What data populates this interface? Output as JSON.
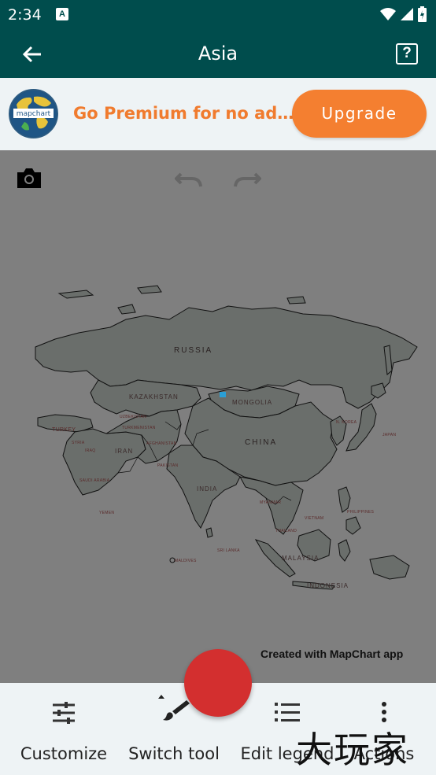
{
  "status_bar": {
    "time": "2:34",
    "notification_icon": "A"
  },
  "app_bar": {
    "title": "Asia",
    "help_label": "?"
  },
  "promo": {
    "text": "Go Premium for no ad…",
    "upgrade_label": "Upgrade",
    "logo_text": "mapchart"
  },
  "map": {
    "labels": {
      "russia": "RUSSIA",
      "kazakhstan": "KAZAKHSTAN",
      "mongolia": "MONGOLIA",
      "china": "CHINA",
      "india": "INDIA",
      "iran": "IRAN",
      "turkey": "TURKEY",
      "syria": "SYRIA",
      "iraq": "IRAQ",
      "saudi_arabia": "SAUDI ARABIA",
      "yemen": "YEMEN",
      "pakistan": "PAKISTAN",
      "afghanistan": "AFGHANISTAN",
      "turkmenistan": "TURKMENISTAN",
      "uzbekistan": "UZBEKISTAN",
      "japan": "JAPAN",
      "north_korea": "N. KOREA",
      "philippines": "PHILIPPINES",
      "indonesia": "INDONESIA",
      "malaysia": "MALAYSIA",
      "maldives": "MALDIVES",
      "vietnam": "VIETNAM",
      "thailand": "THAILAND",
      "myanmar": "MYANMAR",
      "sri_lanka": "SRI LANKA"
    },
    "credit": "Created with MapChart app"
  },
  "toolbar": {
    "customize": "Customize",
    "switch_tool": "Switch tool",
    "edit_legend": "Edit legend",
    "actions": "Actions"
  },
  "fab_color": "#d32f2f",
  "watermark": "大玩家",
  "colors": {
    "primary": "#004d4d",
    "accent": "#f47f30",
    "map_bg": "#7f7f7f",
    "land": "#6a6e6b"
  }
}
